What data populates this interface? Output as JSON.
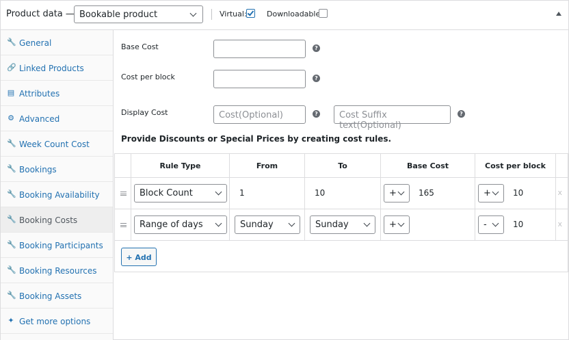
{
  "header": {
    "title": "Product data —",
    "product_type": "Bookable product",
    "virtual_label": "Virtual:",
    "virtual_checked": true,
    "downloadable_label": "Downloadable:",
    "downloadable_checked": false
  },
  "sidebar": {
    "items": [
      {
        "label": "General",
        "icon": "wrench-icon"
      },
      {
        "label": "Linked Products",
        "icon": "link-icon"
      },
      {
        "label": "Attributes",
        "icon": "list-icon"
      },
      {
        "label": "Advanced",
        "icon": "gear-icon"
      },
      {
        "label": "Week Count Cost",
        "icon": "wrench-icon"
      },
      {
        "label": "Bookings",
        "icon": "wrench-icon"
      },
      {
        "label": "Booking Availability",
        "icon": "wrench-icon"
      },
      {
        "label": "Booking Costs",
        "icon": "wrench-icon",
        "active": true
      },
      {
        "label": "Booking Participants",
        "icon": "wrench-icon"
      },
      {
        "label": "Booking Resources",
        "icon": "wrench-icon"
      },
      {
        "label": "Booking Assets",
        "icon": "wrench-icon"
      },
      {
        "label": "Get more options",
        "icon": "star-wrench-icon"
      }
    ]
  },
  "form": {
    "base_cost_label": "Base Cost",
    "base_cost_value": "",
    "cost_per_block_label": "Cost per block",
    "cost_per_block_value": "",
    "display_cost_label": "Display Cost",
    "display_cost_placeholder": "Cost(Optional)",
    "suffix_placeholder": "Cost  Suffix text(Optional)",
    "help_glyph": "?",
    "rules_heading": "Provide Discounts or Special Prices by creating cost rules."
  },
  "table": {
    "headers": [
      "Rule Type",
      "From",
      "To",
      "Base Cost",
      "Cost per block"
    ],
    "rows": [
      {
        "rule_type": "Block Count",
        "from": "1",
        "to": "10",
        "base_op": "+",
        "base_value": "165",
        "block_op": "+",
        "block_value": "10"
      },
      {
        "rule_type": "Range of days",
        "from": "Sunday",
        "to": "Sunday",
        "base_op": "+",
        "base_value": "",
        "block_op": "-",
        "block_value": "10"
      }
    ],
    "delete_glyph": "x",
    "add_label": "+ Add"
  },
  "colors": {
    "accent": "#2271b1",
    "border": "#dcdcde",
    "text": "#1d2327"
  }
}
